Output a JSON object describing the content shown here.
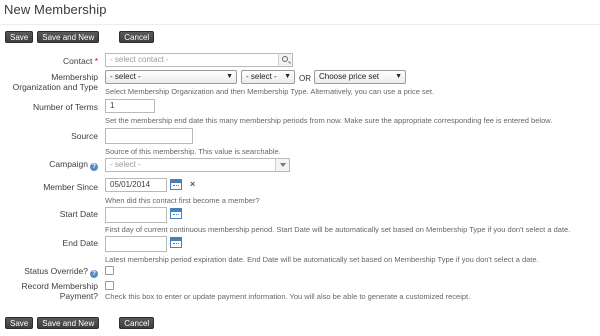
{
  "page": {
    "title": "New Membership"
  },
  "buttons": {
    "save": "Save",
    "save_and_new": "Save and New",
    "cancel": "Cancel"
  },
  "contact": {
    "label": "Contact",
    "required_mark": "*",
    "placeholder": "- select contact -"
  },
  "membership_org": {
    "label_line1": "Membership",
    "label_line2": "Organization and Type",
    "org_select": "- select -",
    "type_select": "- select -",
    "or_text": "OR",
    "price_set_select": "Choose price set",
    "help": "Select Membership Organization and then Membership Type. Alternatively, you can use a price set."
  },
  "num_terms": {
    "label": "Number of Terms",
    "value": "1",
    "help": "Set the membership end date this many membership periods from now. Make sure the appropriate corresponding fee is entered below."
  },
  "source": {
    "label": "Source",
    "value": "",
    "help": "Source of this membership. This value is searchable."
  },
  "campaign": {
    "label": "Campaign",
    "help_icon": "?",
    "placeholder": "- select -"
  },
  "member_since": {
    "label": "Member Since",
    "value": "05/01/2014",
    "clear": "×",
    "help": "When did this contact first become a member?"
  },
  "start_date": {
    "label": "Start Date",
    "value": "",
    "help": "First day of current continuous membership period. Start Date will be automatically set based on Membership Type if you don't select a date."
  },
  "end_date": {
    "label": "End Date",
    "value": "",
    "help": "Latest membership period expiration date. End Date will be automatically set based on Membership Type if you don't select a date."
  },
  "status_override": {
    "label": "Status Override?",
    "help_icon": "?",
    "checked": false
  },
  "record_payment": {
    "label_line1": "Record Membership",
    "label_line2": "Payment?",
    "checked": false,
    "help": "Check this box to enter or update payment information. You will also be able to generate a customized receipt."
  },
  "icons": {
    "search": "search-icon",
    "calendar": "calendar-icon",
    "help": "help-icon",
    "dropdown": "chevron-down-icon"
  },
  "colors": {
    "button_bg": "#4a4a4a",
    "required": "#cc0000",
    "help_icon": "#5b87c6",
    "calendar": "#4a7fb8"
  }
}
